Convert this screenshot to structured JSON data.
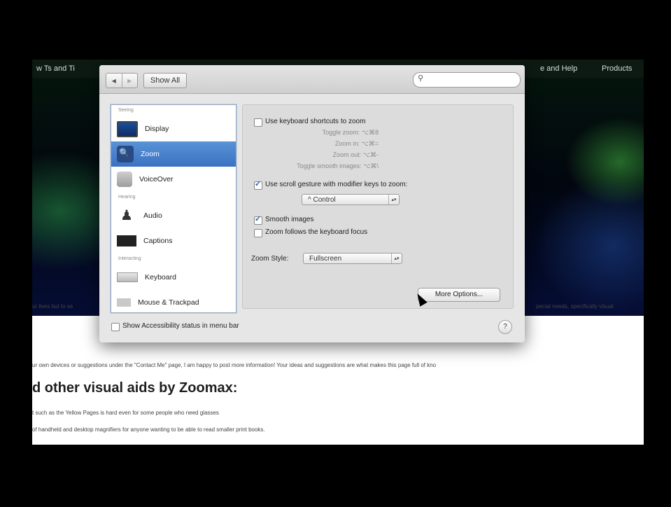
{
  "web_page": {
    "nav_left": "w Ts and Ti",
    "nav_right": [
      "e and Help",
      "Products"
    ],
    "lines": {
      "a": "ur lives but to se",
      "b": "pecial needs, specifically visual",
      "c": "ur own devices or suggestions under the \"Contact Me\" page, I am happy to post more information! Your ideas and suggestions are what makes this page full of kno",
      "d": "t such as the Yellow Pages is hard even for some people who need glasses",
      "e": "of handheld and desktop magnifiers for anyone wanting to be able to read smaller print books."
    },
    "heading": "d other visual aids by Zoomax:"
  },
  "toolbar": {
    "back": "◀",
    "forward": "▶",
    "show_all": "Show All",
    "search_placeholder": ""
  },
  "sidebar": {
    "sections": [
      "Seeing",
      "Hearing",
      "Interacting"
    ],
    "items": [
      {
        "label": "Display",
        "icon": "display-icon"
      },
      {
        "label": "Zoom",
        "icon": "zoom-icon",
        "selected": true
      },
      {
        "label": "VoiceOver",
        "icon": "voiceover-icon"
      },
      {
        "label": "Audio",
        "icon": "audio-icon"
      },
      {
        "label": "Captions",
        "icon": "captions-icon"
      },
      {
        "label": "Keyboard",
        "icon": "keyboard-icon"
      },
      {
        "label": "Mouse & Trackpad",
        "icon": "mouse-icon"
      }
    ]
  },
  "zoom": {
    "keyboard_shortcuts_label": "Use keyboard shortcuts to zoom",
    "keyboard_shortcuts_checked": false,
    "shortcuts": [
      "Toggle zoom: ⌥⌘8",
      "Zoom in: ⌥⌘=",
      "Zoom out: ⌥⌘-",
      "Toggle smooth images: ⌥⌘\\"
    ],
    "scroll_gesture_label": "Use scroll gesture with modifier keys to zoom:",
    "scroll_gesture_checked": true,
    "modifier_value": "^ Control",
    "smooth_images_label": "Smooth images",
    "smooth_images_checked": true,
    "follow_focus_label": "Zoom follows the keyboard focus",
    "follow_focus_checked": false,
    "zoom_style_label": "Zoom Style:",
    "zoom_style_value": "Fullscreen",
    "more_options": "More Options..."
  },
  "footer": {
    "status_label": "Show Accessibility status in menu bar",
    "status_checked": false,
    "help": "?"
  }
}
